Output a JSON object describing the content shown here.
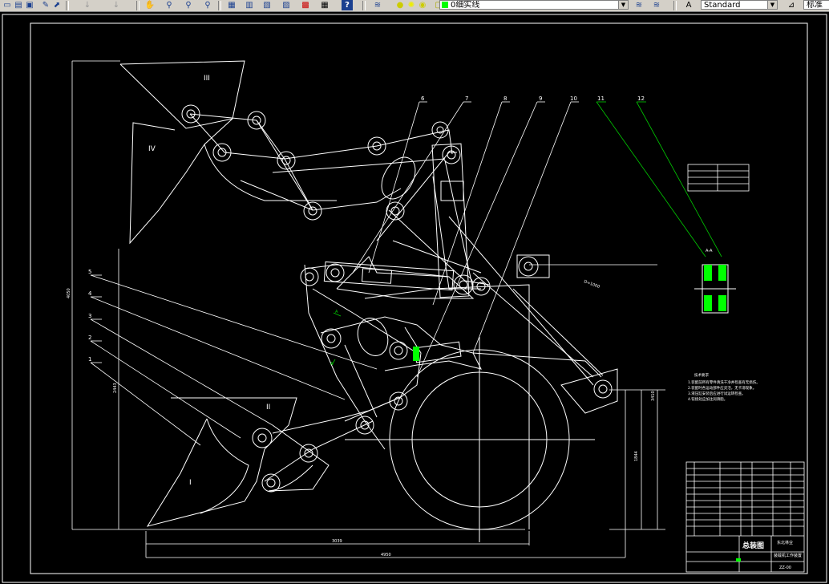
{
  "toolbar": {
    "layer_name": "0细实线",
    "text_style": "Standard",
    "right_label": "标准",
    "help_glyph": "?",
    "icons": [
      "new-icon",
      "open-icon",
      "save-icon",
      "pencil-icon",
      "match-icon",
      "undo-icon",
      "redo-icon",
      "pan-icon",
      "zoom-realtime-icon",
      "zoom-window-icon",
      "zoom-previous-icon",
      "properties-icon",
      "design-center-icon",
      "tool-palette-icon",
      "sheet-set-icon",
      "markup-icon",
      "calculator-icon",
      "help-icon",
      "layer-manager-icon",
      "bulb-icon",
      "sun-icon",
      "lock-icon",
      "color-swatch-icon",
      "layer-previous-icon",
      "layer-state-icon",
      "text-style-icon",
      "dim-style-icon"
    ]
  },
  "drawing": {
    "region_labels": [
      "III",
      "IV",
      "II",
      "I"
    ],
    "part_numbers": [
      "1",
      "2",
      "3",
      "4",
      "5",
      "6",
      "7",
      "8",
      "9",
      "10",
      "11",
      "12"
    ],
    "section_label": "A-A",
    "view_mark": "A",
    "dims": {
      "d3039": "3039",
      "d4950": "4950",
      "d1844": "1844",
      "d3410": "3410",
      "d2443": "2443",
      "d4050": "4050",
      "d1000": "D=1000"
    },
    "notes_title": "技术要求",
    "notes": [
      "1.装配前所有零件清洗干净并检查有无损伤。",
      "2.装配时各运动部件应灵活，无卡滞现象。",
      "3.液压缸安装后应进行试运转检查。",
      "4.铰接处应加注润滑脂。"
    ],
    "title_block": {
      "drawing_title": "总装图",
      "school": "东北林业",
      "project": "装载机工作装置",
      "drawing_no": "ZZ-00"
    }
  },
  "colors": {
    "background": "#000000",
    "line": "#ffffff",
    "leader": "#00cc00",
    "hatch": "#00ff00",
    "toolbar": "#d4d0c8"
  }
}
